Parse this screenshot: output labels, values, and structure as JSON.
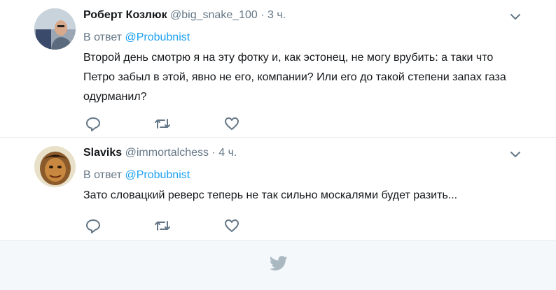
{
  "tweets": [
    {
      "name": "Роберт Козлюк",
      "handle": "@big_snake_100",
      "separator": "·",
      "time": "3 ч.",
      "reply_prefix": "В ответ",
      "reply_mention": "@Probubnist",
      "text": "Второй день смотрю я на эту фотку и, как эстонец, не могу врубить: а таки что Петро забыл в этой, явно не его, компании? Или его до такой степени запах газа одурманил?"
    },
    {
      "name": "Slaviks",
      "handle": "@immortalchess",
      "separator": "·",
      "time": "4 ч.",
      "reply_prefix": "В ответ",
      "reply_mention": "@Probubnist",
      "text": "Зато словацкий реверс теперь не так сильно москалями будет разить..."
    }
  ],
  "icons": {
    "reply": "reply-icon",
    "retweet": "retweet-icon",
    "like": "heart-icon",
    "menu": "chevron-down-icon",
    "footer": "twitter-bird-icon"
  },
  "colors": {
    "text": "#14171a",
    "muted": "#657786",
    "link": "#1da1f2",
    "divider": "#e6ecf0",
    "footer_bg": "#f5f8fa",
    "icon": "#657786",
    "bird": "#aab8c2"
  }
}
